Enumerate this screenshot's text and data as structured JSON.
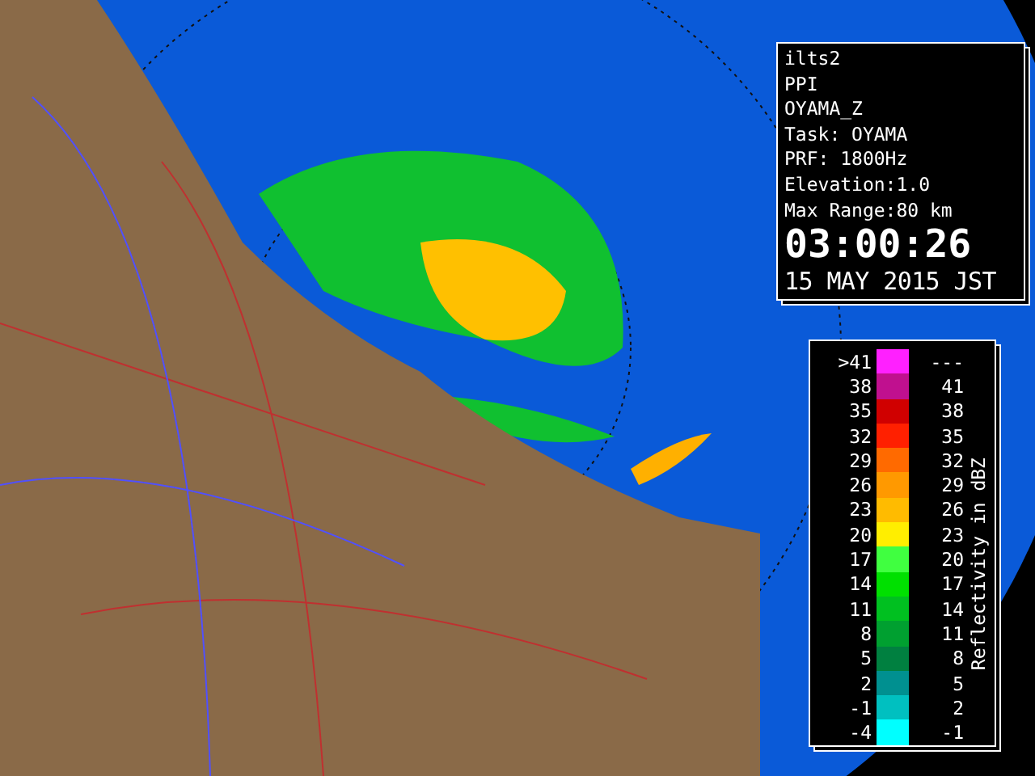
{
  "info": {
    "lines": [
      "ilts2",
      "PPI",
      "OYAMA_Z",
      "Task: OYAMA",
      "PRF: 1800Hz",
      "Elevation:1.0",
      "Max Range:80 km"
    ],
    "time": "03:00:26",
    "date": "15 MAY 2015 JST"
  },
  "legend": {
    "title": "Reflectivity in dBZ",
    "rows": [
      {
        "low": ">41",
        "high": "---",
        "color": "#ff20ff"
      },
      {
        "low": "38",
        "high": "41",
        "color": "#c0108f"
      },
      {
        "low": "35",
        "high": "38",
        "color": "#d00000"
      },
      {
        "low": "32",
        "high": "35",
        "color": "#ff2000"
      },
      {
        "low": "29",
        "high": "32",
        "color": "#ff6a00"
      },
      {
        "low": "26",
        "high": "29",
        "color": "#ff9900"
      },
      {
        "low": "23",
        "high": "26",
        "color": "#ffbb00"
      },
      {
        "low": "20",
        "high": "23",
        "color": "#ffee00"
      },
      {
        "low": "17",
        "high": "20",
        "color": "#40ff40"
      },
      {
        "low": "14",
        "high": "17",
        "color": "#00e000"
      },
      {
        "low": "11",
        "high": "14",
        "color": "#00c020"
      },
      {
        "low": "8",
        "high": "11",
        "color": "#00a030"
      },
      {
        "low": "5",
        "high": "8",
        "color": "#008040"
      },
      {
        "low": "2",
        "high": "5",
        "color": "#009090"
      },
      {
        "low": "-1",
        "high": "2",
        "color": "#00c0c0"
      },
      {
        "low": "-4",
        "high": "-1",
        "color": "#00ffff"
      }
    ]
  }
}
